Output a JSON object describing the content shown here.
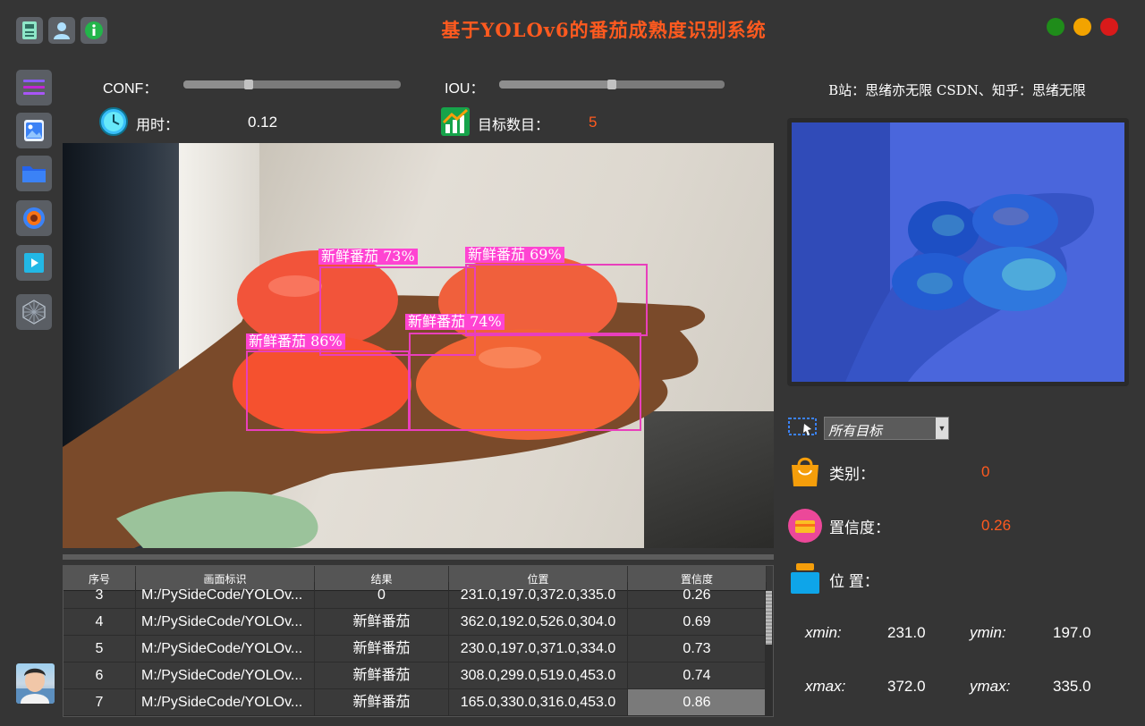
{
  "app": {
    "title": "基于YOLOv6的番茄成熟度识别系统",
    "accent_color": "#ff5a1f"
  },
  "toolbar_icons": [
    "save-icon",
    "user-icon",
    "info-icon"
  ],
  "window_controls": {
    "colors": [
      "#1f8c1a",
      "#f2a300",
      "#d91a1a"
    ]
  },
  "sidebar": {
    "items": [
      "menu-icon",
      "image-icon",
      "folder-icon",
      "camera-icon",
      "video-icon",
      "model-icon"
    ]
  },
  "params": {
    "conf_label": "CONF：",
    "iou_label": "IOU：",
    "conf_value": 0.3,
    "iou_value": 0.5,
    "time_label": "用时：",
    "time_value": "0.12",
    "count_label": "目标数目：",
    "count_value": "5"
  },
  "detections": [
    {
      "label": "新鲜番茄 73%"
    },
    {
      "label": "新鲜番茄 69%"
    },
    {
      "label": "新鲜番茄 74%"
    },
    {
      "label": "新鲜番茄 86%"
    }
  ],
  "credit": "B站：思绪亦无限  CSDN、知乎：思绪无限",
  "target_select": {
    "selected": "所有目标"
  },
  "details": {
    "class_label": "类别：",
    "class_value": "0",
    "conf_label": "置信度：",
    "conf_value": "0.26",
    "pos_label": "位 置：",
    "xmin_label": "xmin:",
    "xmin_value": "231.0",
    "ymin_label": "ymin:",
    "ymin_value": "197.0",
    "xmax_label": "xmax:",
    "xmax_value": "372.0",
    "ymax_label": "ymax:",
    "ymax_value": "335.0"
  },
  "table": {
    "headers": [
      "序号",
      "画面标识",
      "结果",
      "位置",
      "置信度"
    ],
    "rows": [
      [
        "3",
        "M:/PySideCode/YOLOv...",
        "0",
        "231.0,197.0,372.0,335.0",
        "0.26"
      ],
      [
        "4",
        "M:/PySideCode/YOLOv...",
        "新鲜番茄",
        "362.0,192.0,526.0,304.0",
        "0.69"
      ],
      [
        "5",
        "M:/PySideCode/YOLOv...",
        "新鲜番茄",
        "230.0,197.0,371.0,334.0",
        "0.73"
      ],
      [
        "6",
        "M:/PySideCode/YOLOv...",
        "新鲜番茄",
        "308.0,299.0,519.0,453.0",
        "0.74"
      ],
      [
        "7",
        "M:/PySideCode/YOLOv...",
        "新鲜番茄",
        "165.0,330.0,316.0,453.0",
        "0.86"
      ]
    ]
  }
}
